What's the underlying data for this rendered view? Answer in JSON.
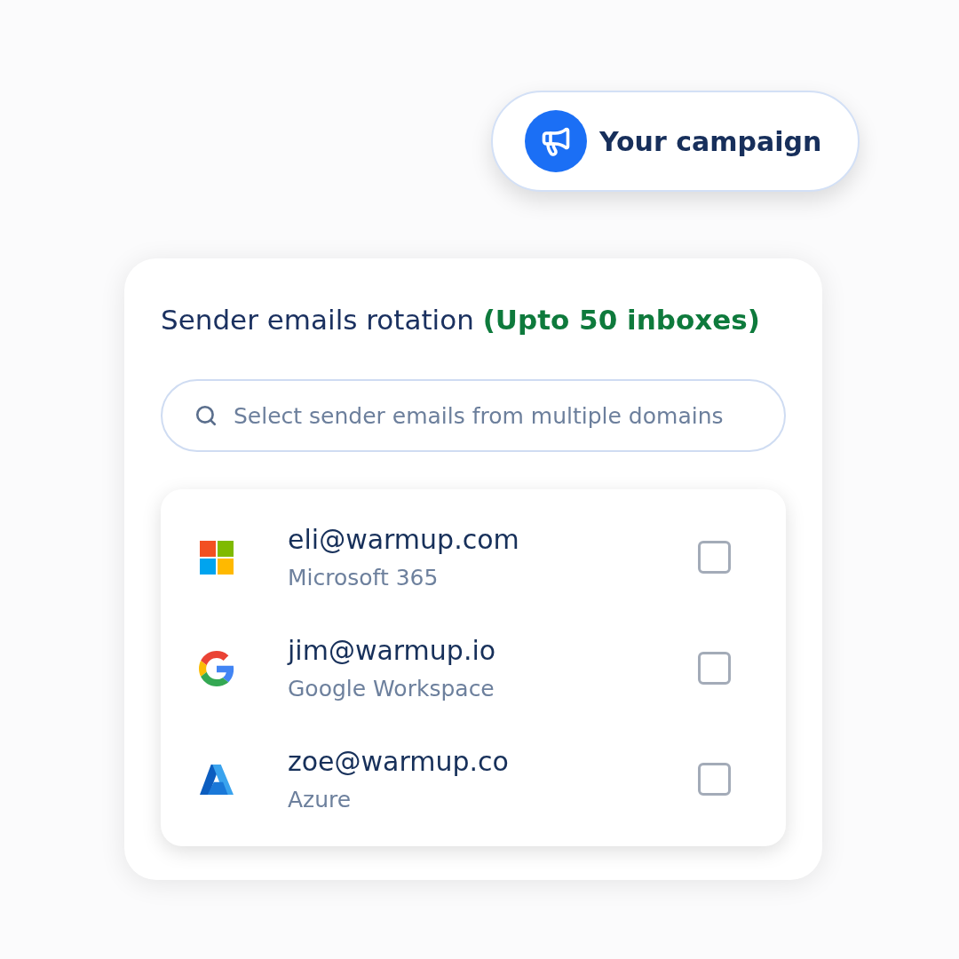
{
  "badge": {
    "label": "Your campaign"
  },
  "card": {
    "title": "Sender emails rotation **(Upto 50 inboxes)**",
    "search": {
      "placeholder": "Select sender emails from multiple domains"
    },
    "accounts": [
      {
        "kind": "microsoft",
        "email": "eli@warmup.com",
        "provider": "Microsoft 365",
        "checked": false
      },
      {
        "kind": "google",
        "email": "jim@warmup.io",
        "provider": "Google Workspace",
        "checked": false
      },
      {
        "kind": "azure",
        "email": "zoe@warmup.co",
        "provider": "Azure",
        "checked": false
      }
    ]
  }
}
